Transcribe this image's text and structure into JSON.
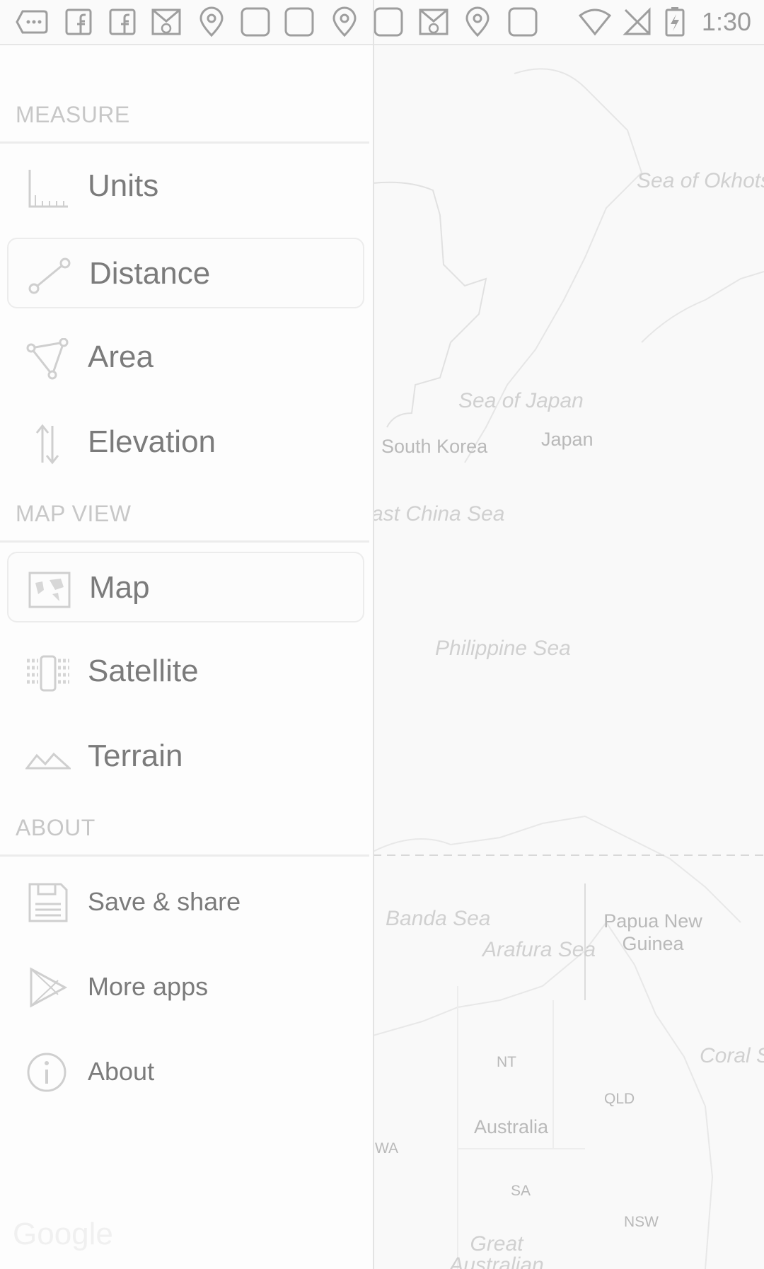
{
  "status_bar": {
    "time": "1:30",
    "icons": [
      "more-icon",
      "facebook-icon",
      "facebook-icon",
      "cat-mail-icon",
      "location-pin-icon",
      "blank-square-icon",
      "blank-square-icon",
      "location-pin-icon",
      "blank-square-icon",
      "cat-mail-icon",
      "location-pin-icon",
      "blank-square-icon",
      "wifi-icon",
      "no-sim-icon",
      "battery-charging-icon"
    ]
  },
  "drawer": {
    "sections": [
      {
        "header": "MEASURE",
        "items": [
          {
            "label": "Units",
            "icon": "ruler-icon",
            "selected": false
          },
          {
            "label": "Distance",
            "icon": "distance-line-icon",
            "selected": true
          },
          {
            "label": "Area",
            "icon": "area-polygon-icon",
            "selected": false
          },
          {
            "label": "Elevation",
            "icon": "elevation-arrows-icon",
            "selected": false
          }
        ]
      },
      {
        "header": "MAP VIEW",
        "items": [
          {
            "label": "Map",
            "icon": "world-map-icon",
            "selected": true
          },
          {
            "label": "Satellite",
            "icon": "satellite-icon",
            "selected": false
          },
          {
            "label": "Terrain",
            "icon": "terrain-icon",
            "selected": false
          }
        ]
      },
      {
        "header": "ABOUT",
        "items": [
          {
            "label": "Save & share",
            "icon": "floppy-save-icon",
            "selected": false
          },
          {
            "label": "More apps",
            "icon": "play-store-icon",
            "selected": false
          },
          {
            "label": "About",
            "icon": "info-icon",
            "selected": false
          }
        ]
      }
    ]
  },
  "map": {
    "labels": [
      {
        "text": "Sea of Okhotsk",
        "kind": "sea"
      },
      {
        "text": "Sea of Japan",
        "kind": "sea"
      },
      {
        "text": "South Korea",
        "kind": "country"
      },
      {
        "text": "Japan",
        "kind": "country"
      },
      {
        "text": "ast China Sea",
        "kind": "sea"
      },
      {
        "text": "Philippine Sea",
        "kind": "sea"
      },
      {
        "text": "Banda Sea",
        "kind": "sea"
      },
      {
        "text": "Arafura Sea",
        "kind": "sea"
      },
      {
        "text": "Papua New Guinea",
        "kind": "country"
      },
      {
        "text": "Coral S",
        "kind": "sea"
      },
      {
        "text": "NT",
        "kind": "region"
      },
      {
        "text": "QLD",
        "kind": "region"
      },
      {
        "text": "Australia",
        "kind": "country"
      },
      {
        "text": "WA",
        "kind": "region"
      },
      {
        "text": "SA",
        "kind": "region"
      },
      {
        "text": "NSW",
        "kind": "region"
      },
      {
        "text": "Great Australian",
        "kind": "sea"
      }
    ],
    "watermark": "Google"
  }
}
